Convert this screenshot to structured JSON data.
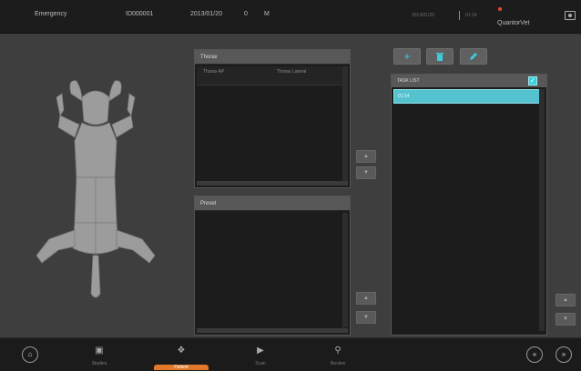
{
  "header": {
    "patient_name": "Emergency",
    "patient_id": "ID000001",
    "date": "2013/01/20",
    "age": "0",
    "sex": "M",
    "sys_date": "2013/01/20",
    "sys_time": "01:14",
    "brand": "QuantorVet"
  },
  "thorax_panel": {
    "title": "Thorax",
    "columns": [
      "Thorax AP",
      "Thorax Lateral"
    ]
  },
  "preset_panel": {
    "title": "Preset"
  },
  "task_list": {
    "header": "TASK LIST",
    "rows": [
      "01:14"
    ]
  },
  "toolbar_icons": [
    "plus-icon",
    "trash-icon",
    "pencil-icon"
  ],
  "nav": {
    "studies": "Studies",
    "patient": "Patient",
    "scan": "Scan",
    "review": "Review"
  },
  "colors": {
    "accent": "#3dcde0",
    "brand": "#e07a2a",
    "selection": "#55c3cf"
  }
}
